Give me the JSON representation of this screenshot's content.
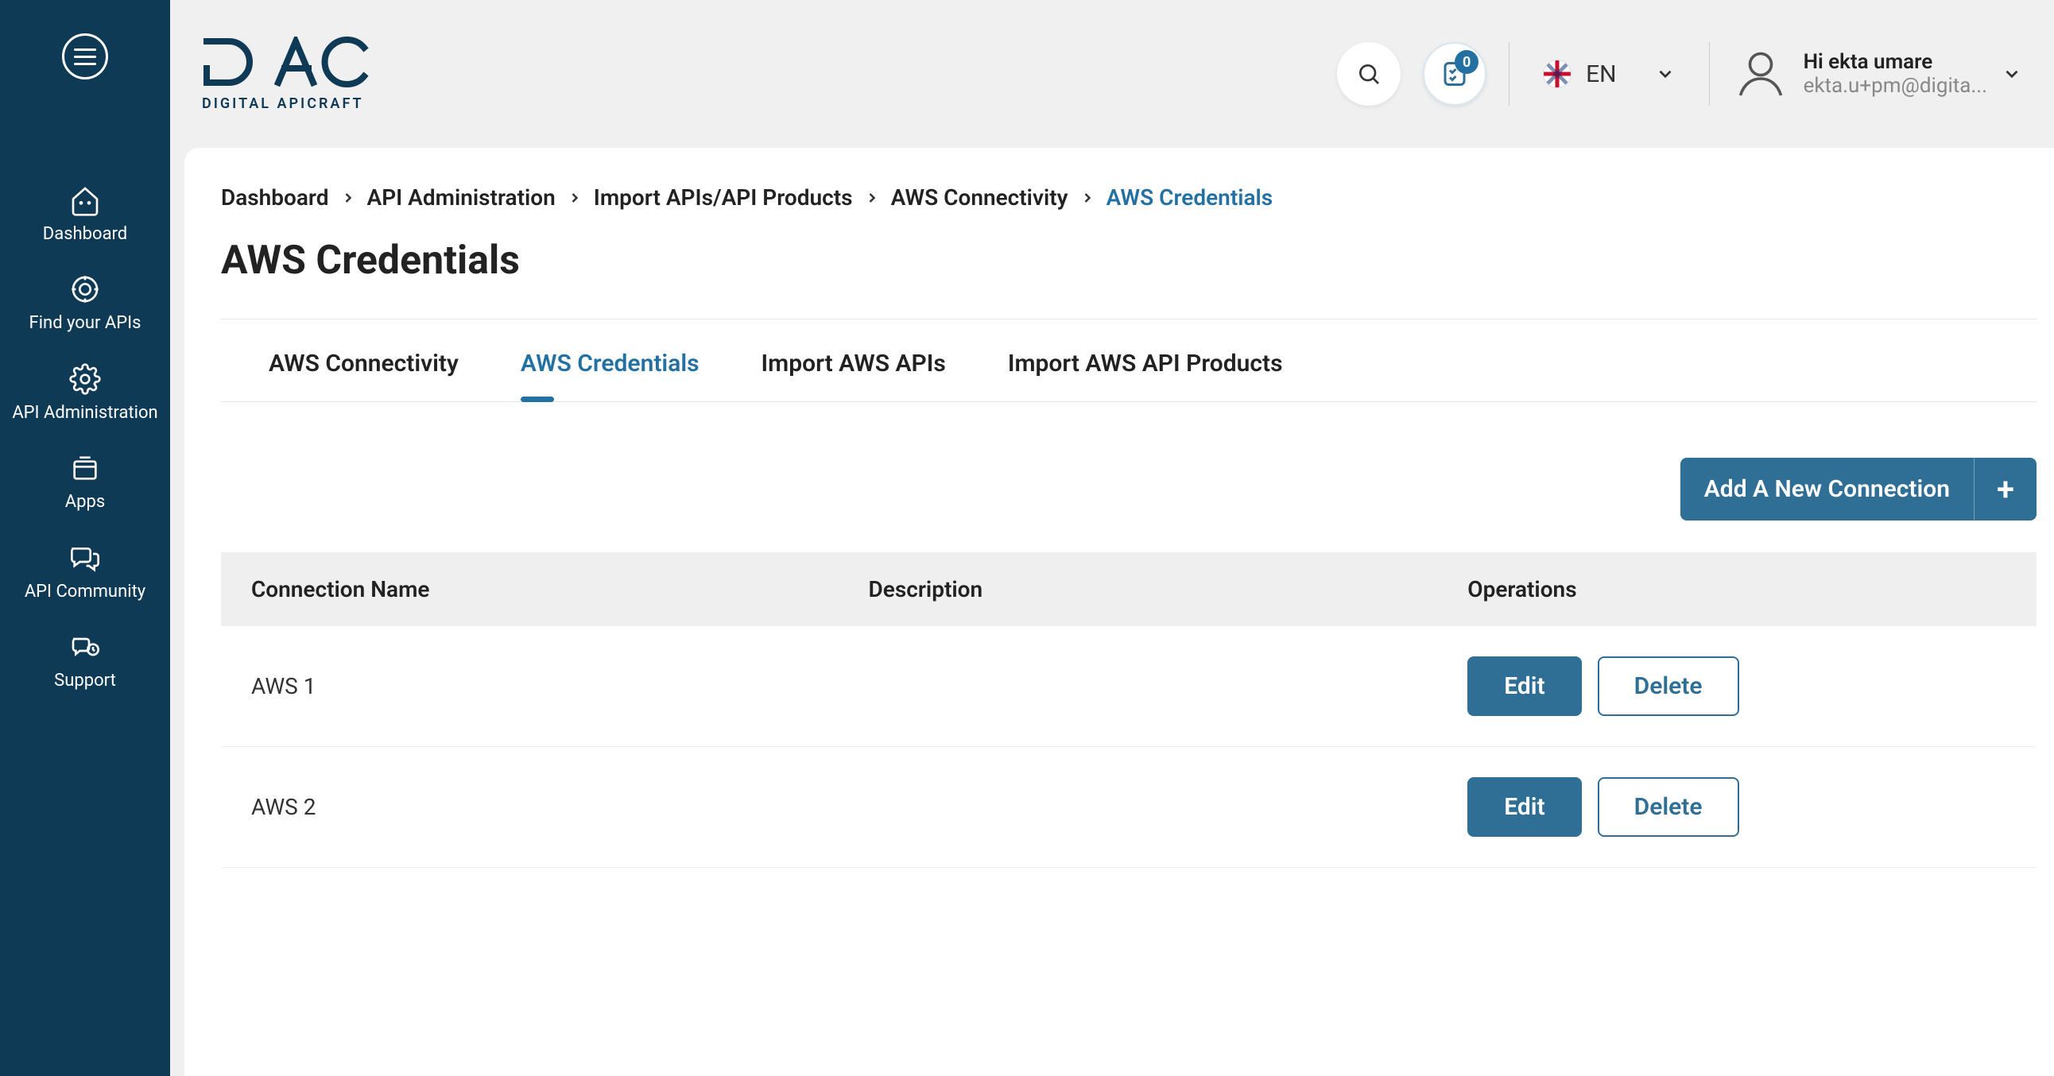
{
  "header": {
    "logo_main": "DAC",
    "logo_sub": "DIGITAL APICRAFT",
    "notifications_badge": "0",
    "language": "EN",
    "user_greeting": "Hi ekta umare",
    "user_email": "ekta.u+pm@digita..."
  },
  "sidebar": {
    "items": [
      {
        "label": "Dashboard",
        "icon": "home-icon"
      },
      {
        "label": "Find your APIs",
        "icon": "target-icon"
      },
      {
        "label": "API Administration",
        "icon": "gear-icon"
      },
      {
        "label": "Apps",
        "icon": "apps-icon"
      },
      {
        "label": "API Community",
        "icon": "community-icon"
      },
      {
        "label": "Support",
        "icon": "support-icon"
      }
    ]
  },
  "breadcrumb": [
    {
      "label": "Dashboard",
      "active": false
    },
    {
      "label": "API Administration",
      "active": false
    },
    {
      "label": "Import APIs/API Products",
      "active": false
    },
    {
      "label": "AWS Connectivity",
      "active": false
    },
    {
      "label": "AWS Credentials",
      "active": true
    }
  ],
  "page_title": "AWS Credentials",
  "tabs": [
    {
      "label": "AWS Connectivity",
      "active": false
    },
    {
      "label": "AWS Credentials",
      "active": true
    },
    {
      "label": "Import AWS APIs",
      "active": false
    },
    {
      "label": "Import AWS API Products",
      "active": false
    }
  ],
  "actions": {
    "add_connection_label": "Add A New Connection"
  },
  "table": {
    "columns": [
      "Connection Name",
      "Description",
      "Operations"
    ],
    "rows": [
      {
        "name": "AWS 1",
        "description": ""
      },
      {
        "name": "AWS 2",
        "description": ""
      }
    ],
    "ops": {
      "edit": "Edit",
      "delete": "Delete"
    }
  }
}
